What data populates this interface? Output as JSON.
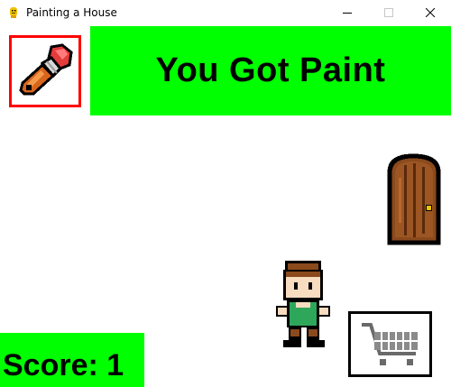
{
  "window": {
    "title": "Painting a House",
    "icons": {
      "app": "pygame-snake-icon",
      "minimize": "minimize-icon",
      "maximize": "maximize-icon",
      "close": "close-icon"
    }
  },
  "game": {
    "banner_message": "You Got Paint",
    "score_text": "Score: 1",
    "held_item": "paintbrush-icon",
    "colors": {
      "banner_bg": "#00ff00",
      "score_bg": "#00ff00",
      "item_border": "#ff0000",
      "shirt": "#2fa75a",
      "door": "#8b4a1c"
    }
  }
}
